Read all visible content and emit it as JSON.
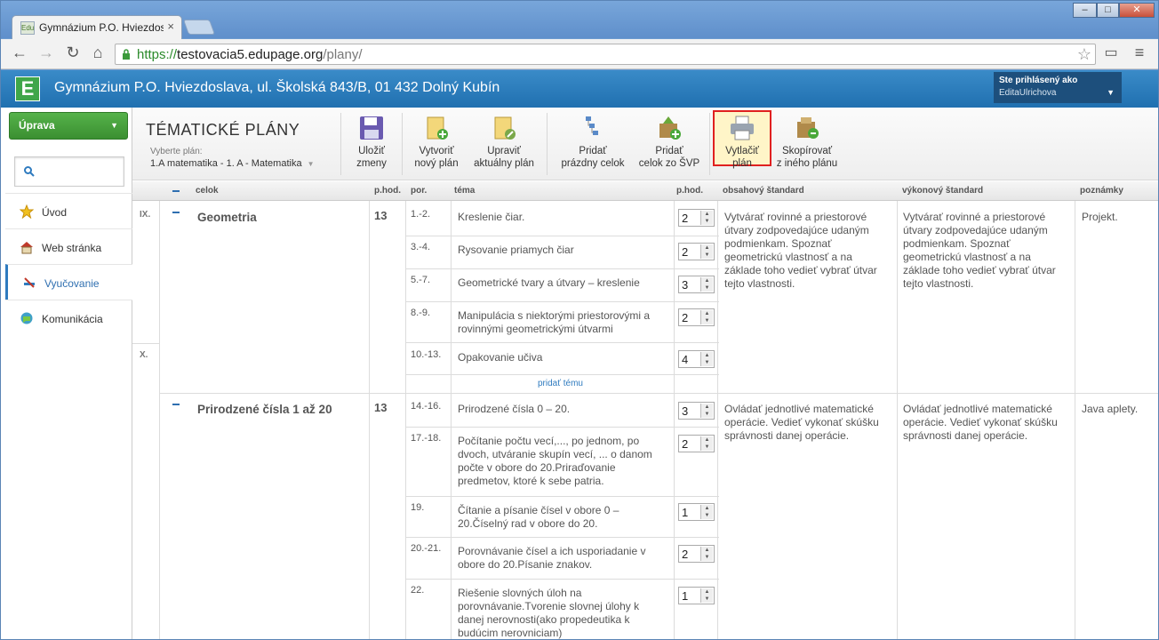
{
  "browser": {
    "tab_title": "Gymnázium P.O. Hviezdoslava",
    "tab_favicon": "Edu",
    "url_prefix": "https://",
    "url_host": "testovacia5.edupage.org",
    "url_path": "/plany/",
    "window_buttons": [
      "–",
      "□",
      "✕"
    ]
  },
  "app": {
    "logo_letter": "E",
    "school_name": "Gymnázium P.O. Hviezdoslava, ul. Školská 843/B, 01 432 Dolný Kubín",
    "user_label": "Ste prihlásený ako",
    "user_name": "EditaUlrichova"
  },
  "sidebar": {
    "uprava_label": "Úprava",
    "items": [
      {
        "label": "Úvod",
        "icon": "star-icon"
      },
      {
        "label": "Web stránka",
        "icon": "house-icon"
      },
      {
        "label": "Vyučovanie",
        "icon": "teaching-icon",
        "active": true
      },
      {
        "label": "Komunikácia",
        "icon": "communication-icon"
      }
    ]
  },
  "ribbon": {
    "title": "TÉMATICKÉ PLÁNY",
    "plan_label": "Vyberte plán:",
    "plan_value": "1.A matematika - 1. A - Matematika",
    "buttons": [
      {
        "line1": "Uložiť",
        "line2": "zmeny",
        "icon": "save-icon"
      },
      {
        "line1": "Vytvoriť",
        "line2": "nový plán",
        "icon": "new-plan-icon"
      },
      {
        "line1": "Upraviť",
        "line2": "aktuálny plán",
        "icon": "edit-plan-icon"
      },
      {
        "line1": "Pridať",
        "line2": "prázdny celok",
        "icon": "add-empty-unit-icon"
      },
      {
        "line1": "Pridať",
        "line2": "celok zo ŠVP",
        "icon": "add-unit-svp-icon"
      },
      {
        "line1": "Vytlačiť",
        "line2": "plán",
        "icon": "printer-icon"
      },
      {
        "line1": "Skopírovať",
        "line2": "z iného plánu",
        "icon": "copy-plan-icon"
      }
    ]
  },
  "table": {
    "headers": {
      "celok": "celok",
      "phod": "p.hod.",
      "por": "por.",
      "tema": "téma",
      "phod2": "p.hod.",
      "obsahovy": "obsahový štandard",
      "vykonovy": "výkonový štandard",
      "poznamky": "poznámky"
    },
    "months": [
      "IX.",
      "X."
    ],
    "add_topic": "pridať tému",
    "units": [
      {
        "name": "Geometria",
        "hours": "13",
        "obsahovy": "Vytvárať rovinné a priestorové útvary zodpovedajúce udaným podmienkam.  Spoznať geometrickú vlastnosť a na základe toho vedieť vybrať útvar tejto vlastnosti.",
        "vykonovy": "Vytvárať rovinné a priestorové útvary zodpovedajúce udaným podmienkam.  Spoznať geometrickú vlastnosť a na základe toho vedieť vybrať útvar tejto vlastnosti.",
        "poznamky": "Projekt.",
        "topics": [
          {
            "por": "1.-2.",
            "tema": "Kreslenie čiar.",
            "hod": "2"
          },
          {
            "por": "3.-4.",
            "tema": "Rysovanie priamych čiar",
            "hod": "2"
          },
          {
            "por": "5.-7.",
            "tema": "Geometrické tvary a útvary – kreslenie",
            "hod": "3"
          },
          {
            "por": "8.-9.",
            "tema": "Manipulácia s niektorými priestorovými a rovinnými geometrickými útvarmi",
            "hod": "2"
          },
          {
            "por": "10.-13.",
            "tema": "Opakovanie učiva",
            "hod": "4"
          }
        ]
      },
      {
        "name": "Prirodzené čísla 1 až 20",
        "hours": "13",
        "obsahovy": "Ovládať jednotlivé matematické operácie. Vedieť vykonať skúšku správnosti danej operácie.",
        "vykonovy": "Ovládať jednotlivé matematické operácie. Vedieť vykonať skúšku správnosti danej operácie.",
        "poznamky": "Java aplety.",
        "topics": [
          {
            "por": "14.-16.",
            "tema": "Prirodzené čísla 0 – 20.",
            "hod": "3"
          },
          {
            "por": "17.-18.",
            "tema": "Počítanie počtu vecí,..., po jednom, po dvoch, utváranie skupín vecí, ... o danom počte v obore do 20.Priraďovanie predmetov, ktoré k sebe patria.",
            "hod": "2"
          },
          {
            "por": "19.",
            "tema": "Čítanie a písanie čísel v obore 0 – 20.Číselný rad v obore do 20.",
            "hod": "1"
          },
          {
            "por": "20.-21.",
            "tema": "Porovnávanie čísel a ich usporiadanie v obore do 20.Písanie znakov.",
            "hod": "2"
          },
          {
            "por": "22.",
            "tema": "Riešenie slovných úloh na porovnávanie.Tvorenie slovnej úlohy k danej nerovnosti(ako propedeutika k budúcim nerovniciam)",
            "hod": "1"
          }
        ]
      }
    ]
  },
  "colors": {
    "accent": "#2f7bbf",
    "green": "#3b8f31",
    "highlight": "#e02020"
  }
}
